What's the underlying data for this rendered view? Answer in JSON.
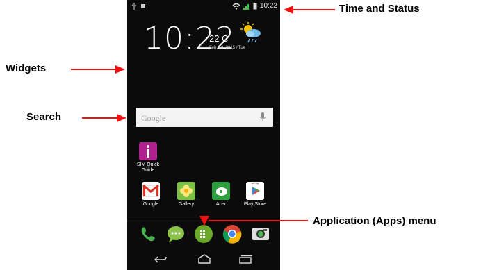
{
  "annotations": {
    "time_status": "Time and Status",
    "widgets": "Widgets",
    "search": "Search",
    "apps_menu": "Application (Apps) menu"
  },
  "status_bar": {
    "time": "10:22"
  },
  "clock_widget": {
    "time": "10:22",
    "temperature": "22 C",
    "date": "Feb. 10, 2015 / Tue",
    "icon": "partly-cloudy-rain-icon"
  },
  "search_bar": {
    "placeholder": "Google",
    "icon": "mic-icon"
  },
  "home_apps": [
    {
      "label": "SIM Quick Guide",
      "icon": "sim-guide-icon"
    },
    {
      "label": "Google",
      "icon": "gmail-folder-icon"
    },
    {
      "label": "Gallery",
      "icon": "gallery-icon"
    },
    {
      "label": "Acer",
      "icon": "acer-folder-icon"
    },
    {
      "label": "Play Store",
      "icon": "play-store-icon"
    }
  ],
  "dock": [
    "phone-icon",
    "messaging-icon",
    "apps-drawer-icon",
    "chrome-icon",
    "camera-icon"
  ],
  "nav": [
    "back-icon",
    "home-icon",
    "recents-icon"
  ],
  "colors": {
    "arrow": "#e11111",
    "screen_bg": "#0b0b0b"
  }
}
